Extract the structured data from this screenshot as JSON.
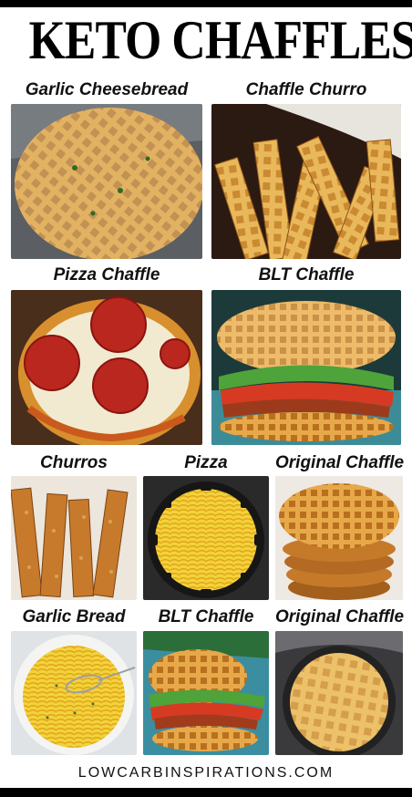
{
  "title": "KETO CHAFFLES",
  "photos": [
    {
      "caption": "Garlic Cheesebread"
    },
    {
      "caption": "Chaffle Churro"
    },
    {
      "caption": "Pizza Chaffle"
    },
    {
      "caption": "BLT Chaffle"
    },
    {
      "caption": "Churros"
    },
    {
      "caption": "Pizza"
    },
    {
      "caption": "Original Chaffle"
    },
    {
      "caption": "Garlic Bread"
    },
    {
      "caption": "BLT Chaffle"
    },
    {
      "caption": "Original Chaffle"
    }
  ],
  "footer": "LOWCARBINSPIRATIONS.COM"
}
